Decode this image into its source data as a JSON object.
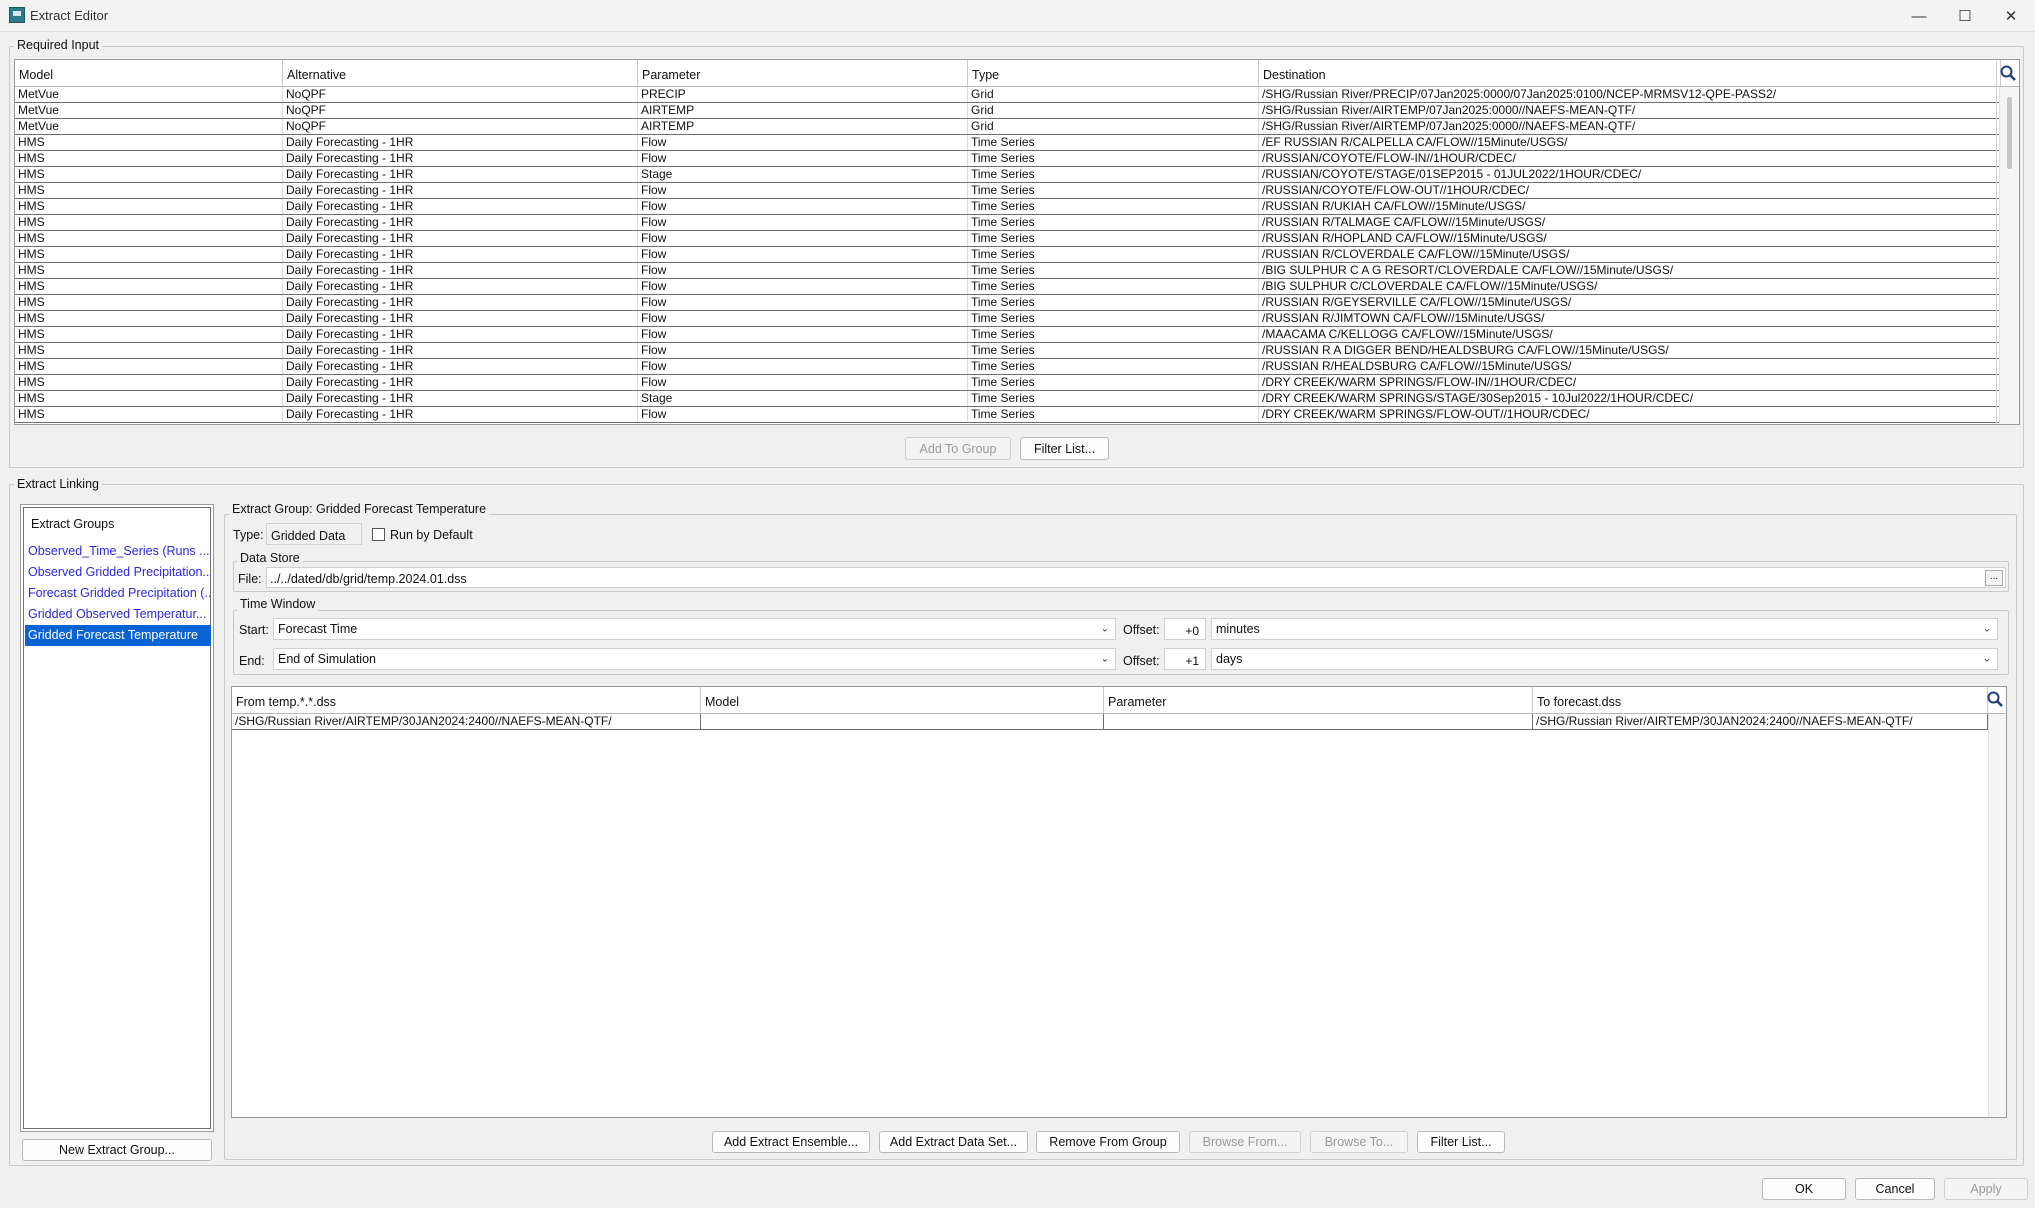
{
  "window": {
    "title": "Extract Editor",
    "minimize_glyph": "—",
    "maximize_glyph": "☐",
    "close_glyph": "✕"
  },
  "required_input": {
    "legend": "Required Input",
    "columns": [
      "Model",
      "Alternative",
      "Parameter",
      "Type",
      "Destination"
    ],
    "rows": [
      [
        "MetVue",
        "NoQPF",
        "PRECIP",
        "Grid",
        "/SHG/Russian River/PRECIP/07Jan2025:0000/07Jan2025:0100/NCEP-MRMSV12-QPE-PASS2/"
      ],
      [
        "MetVue",
        "NoQPF",
        "AIRTEMP",
        "Grid",
        "/SHG/Russian River/AIRTEMP/07Jan2025:0000//NAEFS-MEAN-QTF/"
      ],
      [
        "MetVue",
        "NoQPF",
        "AIRTEMP",
        "Grid",
        "/SHG/Russian River/AIRTEMP/07Jan2025:0000//NAEFS-MEAN-QTF/"
      ],
      [
        "HMS",
        "Daily Forecasting - 1HR",
        "Flow",
        "Time Series",
        "/EF RUSSIAN R/CALPELLA CA/FLOW//15Minute/USGS/"
      ],
      [
        "HMS",
        "Daily Forecasting - 1HR",
        "Flow",
        "Time Series",
        "/RUSSIAN/COYOTE/FLOW-IN//1HOUR/CDEC/"
      ],
      [
        "HMS",
        "Daily Forecasting - 1HR",
        "Stage",
        "Time Series",
        "/RUSSIAN/COYOTE/STAGE/01SEP2015 - 01JUL2022/1HOUR/CDEC/"
      ],
      [
        "HMS",
        "Daily Forecasting - 1HR",
        "Flow",
        "Time Series",
        "/RUSSIAN/COYOTE/FLOW-OUT//1HOUR/CDEC/"
      ],
      [
        "HMS",
        "Daily Forecasting - 1HR",
        "Flow",
        "Time Series",
        "/RUSSIAN R/UKIAH CA/FLOW//15Minute/USGS/"
      ],
      [
        "HMS",
        "Daily Forecasting - 1HR",
        "Flow",
        "Time Series",
        "/RUSSIAN R/TALMAGE CA/FLOW//15Minute/USGS/"
      ],
      [
        "HMS",
        "Daily Forecasting - 1HR",
        "Flow",
        "Time Series",
        "/RUSSIAN R/HOPLAND CA/FLOW//15Minute/USGS/"
      ],
      [
        "HMS",
        "Daily Forecasting - 1HR",
        "Flow",
        "Time Series",
        "/RUSSIAN R/CLOVERDALE CA/FLOW//15Minute/USGS/"
      ],
      [
        "HMS",
        "Daily Forecasting - 1HR",
        "Flow",
        "Time Series",
        "/BIG SULPHUR C A G RESORT/CLOVERDALE CA/FLOW//15Minute/USGS/"
      ],
      [
        "HMS",
        "Daily Forecasting - 1HR",
        "Flow",
        "Time Series",
        "/BIG SULPHUR C/CLOVERDALE CA/FLOW//15Minute/USGS/"
      ],
      [
        "HMS",
        "Daily Forecasting - 1HR",
        "Flow",
        "Time Series",
        "/RUSSIAN R/GEYSERVILLE CA/FLOW//15Minute/USGS/"
      ],
      [
        "HMS",
        "Daily Forecasting - 1HR",
        "Flow",
        "Time Series",
        "/RUSSIAN R/JIMTOWN CA/FLOW//15Minute/USGS/"
      ],
      [
        "HMS",
        "Daily Forecasting - 1HR",
        "Flow",
        "Time Series",
        "/MAACAMA C/KELLOGG CA/FLOW//15Minute/USGS/"
      ],
      [
        "HMS",
        "Daily Forecasting - 1HR",
        "Flow",
        "Time Series",
        "/RUSSIAN R A DIGGER BEND/HEALDSBURG CA/FLOW//15Minute/USGS/"
      ],
      [
        "HMS",
        "Daily Forecasting - 1HR",
        "Flow",
        "Time Series",
        "/RUSSIAN R/HEALDSBURG CA/FLOW//15Minute/USGS/"
      ],
      [
        "HMS",
        "Daily Forecasting - 1HR",
        "Flow",
        "Time Series",
        "/DRY CREEK/WARM SPRINGS/FLOW-IN//1HOUR/CDEC/"
      ],
      [
        "HMS",
        "Daily Forecasting - 1HR",
        "Stage",
        "Time Series",
        "/DRY CREEK/WARM SPRINGS/STAGE/30Sep2015 - 10Jul2022/1HOUR/CDEC/"
      ],
      [
        "HMS",
        "Daily Forecasting - 1HR",
        "Flow",
        "Time Series",
        "/DRY CREEK/WARM SPRINGS/FLOW-OUT//1HOUR/CDEC/"
      ]
    ],
    "add_to_group_label": "Add To Group",
    "filter_list_label": "Filter List..."
  },
  "extract_linking": {
    "legend": "Extract Linking",
    "groups_title": "Extract Groups",
    "groups": [
      "Observed_Time_Series (Runs ...",
      "Observed Gridded Precipitation...",
      "Forecast Gridded Precipitation (...",
      "Gridded Observed Temperatur...",
      "Gridded Forecast Temperature"
    ],
    "selected_group_index": 4,
    "new_group_label": "New Extract Group...",
    "group_legend": "Extract Group: Gridded Forecast Temperature",
    "type_label": "Type:",
    "type_value": "Gridded Data",
    "run_by_default_label": "Run by Default",
    "data_store_legend": "Data Store",
    "file_label": "File:",
    "file_value": "../../dated/db/grid/temp.2024.01.dss",
    "file_browse_label": "...",
    "time_window_legend": "Time Window",
    "start_label": "Start:",
    "start_value": "Forecast Time",
    "start_offset_label": "Offset:",
    "start_offset_value": "+0",
    "start_unit": "minutes",
    "end_label": "End:",
    "end_value": "End of Simulation",
    "end_offset_label": "Offset:",
    "end_offset_value": "+1",
    "end_unit": "days",
    "mapping_columns": [
      "From temp.*.*.dss",
      "Model",
      "Parameter",
      "To forecast.dss"
    ],
    "mapping_rows": [
      [
        "/SHG/Russian River/AIRTEMP/30JAN2024:2400//NAEFS-MEAN-QTF/",
        "",
        "",
        "/SHG/Russian River/AIRTEMP/30JAN2024:2400//NAEFS-MEAN-QTF/"
      ]
    ],
    "buttons": {
      "add_ensemble": "Add Extract Ensemble...",
      "add_data_set": "Add Extract Data Set...",
      "remove_from_group": "Remove From Group",
      "browse_from": "Browse From...",
      "browse_to": "Browse To...",
      "filter_list": "Filter List..."
    }
  },
  "footer": {
    "ok": "OK",
    "cancel": "Cancel",
    "apply": "Apply"
  },
  "colors": {
    "selection": "#0a63d4",
    "link_text": "#2a2ae0",
    "background": "#f0f0f0"
  }
}
